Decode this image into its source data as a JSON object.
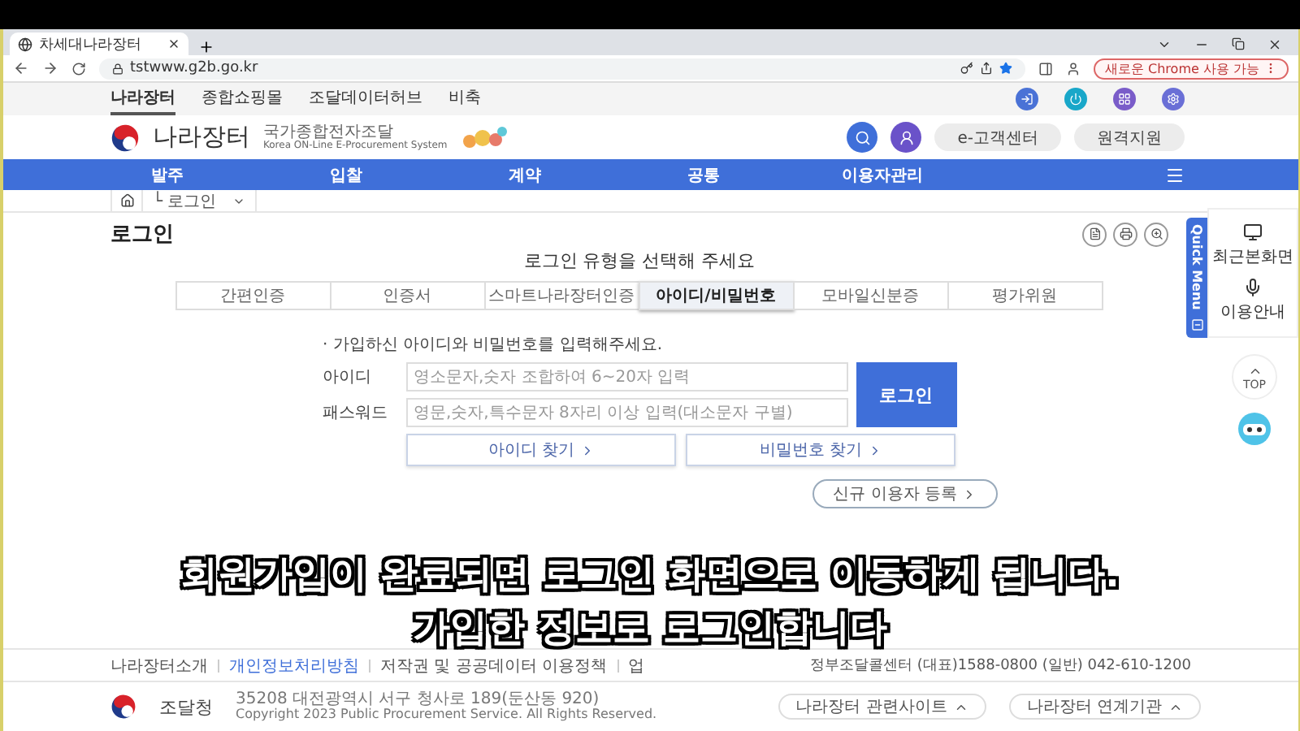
{
  "browser": {
    "tab_title": "차세대나라장터",
    "url": "tstwww.g2b.go.kr",
    "update_button": "새로운 Chrome 사용 가능"
  },
  "utility_bar": {
    "links": [
      {
        "label": "나라장터",
        "selected": true
      },
      {
        "label": "종합쇼핑몰",
        "selected": false
      },
      {
        "label": "조달데이터허브",
        "selected": false
      },
      {
        "label": "비축",
        "selected": false
      }
    ]
  },
  "header": {
    "logo_title": "나라장터",
    "logo_subtitle": "국가종합전자조달",
    "logo_english": "Korea ON-Line E-Procurement System",
    "buttons": [
      "e-고객센터",
      "원격지원"
    ]
  },
  "nav": {
    "items": [
      "발주",
      "입찰",
      "계약",
      "공통",
      "이용자관리"
    ]
  },
  "breadcrumb": {
    "current": "└ 로그인"
  },
  "page_title": "로그인",
  "login": {
    "prompt": "로그인 유형을 선택해 주세요",
    "tabs": [
      {
        "label": "간편인증",
        "selected": false
      },
      {
        "label": "인증서",
        "selected": false
      },
      {
        "label": "스마트나라장터인증",
        "selected": false
      },
      {
        "label": "아이디/비밀번호",
        "selected": true
      },
      {
        "label": "모바일신분증",
        "selected": false
      },
      {
        "label": "평가위원",
        "selected": false
      }
    ],
    "guide": "· 가입하신 아이디와 비밀번호를 입력해주세요.",
    "fields": [
      {
        "label": "아이디",
        "placeholder": "영소문자,숫자 조합하여 6~20자 입력"
      },
      {
        "label": "패스워드",
        "placeholder": "영문,숫자,특수문자 8자리 이상 입력(대소문자 구별)"
      }
    ],
    "submit": "로그인",
    "find_buttons": [
      "아이디 찾기",
      "비밀번호 찾기"
    ],
    "register": "신규 이용자 등록"
  },
  "quick_menu": {
    "title": "Quick Menu",
    "items": [
      "최근본화면",
      "이용안내"
    ],
    "top": "TOP"
  },
  "footer": {
    "links": [
      {
        "label": "나라장터소개",
        "highlighted": false
      },
      {
        "label": "개인정보처리방침",
        "highlighted": true
      },
      {
        "label": "저작권 및 공공데이터 이용정책",
        "highlighted": false
      },
      {
        "label": "업",
        "highlighted": false
      }
    ],
    "call_center": "정부조달콜센터 (대표)1588-0800 (일반) 042-610-1200",
    "agency": "조달청",
    "address": "35208 대전광역시 서구 청사로 189(둔산동 920)",
    "copyright": "Copyright 2023 Public Procurement Service. All Rights Reserved.",
    "site_buttons": [
      "나라장터 관련사이트",
      "나라장터 연계기관"
    ]
  },
  "subtitles": [
    "회원가입이 완료되면 로그인 화면으로 이동하게 됩니다.",
    "가입한 정보로 로그인합니다"
  ]
}
